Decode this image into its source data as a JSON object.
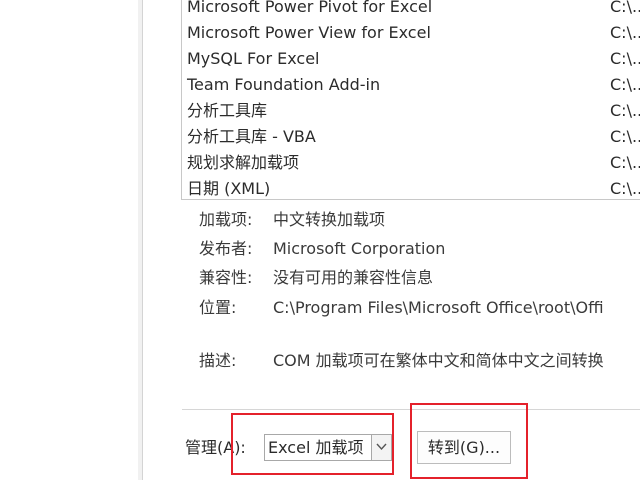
{
  "addins_list": {
    "items": [
      {
        "name": "Microsoft Power Pivot for Excel",
        "location": "C:\\..."
      },
      {
        "name": "Microsoft Power View for Excel",
        "location": "C:\\..."
      },
      {
        "name": "MySQL For Excel",
        "location": "C:\\..."
      },
      {
        "name": "Team Foundation Add-in",
        "location": "C:\\..."
      },
      {
        "name": "分析工具库",
        "location": "C:\\..."
      },
      {
        "name": "分析工具库 - VBA",
        "location": "C:\\..."
      },
      {
        "name": "规划求解加载项",
        "location": "C:\\..."
      },
      {
        "name": "日期 (XML)",
        "location": "C:\\..."
      }
    ]
  },
  "details": {
    "addin_label": "加载项:",
    "addin_value": "中文转换加载项",
    "publisher_label": "发布者:",
    "publisher_value": "Microsoft Corporation",
    "compat_label": "兼容性:",
    "compat_value": "没有可用的兼容性信息",
    "location_label": "位置:",
    "location_value": "C:\\Program Files\\Microsoft Office\\root\\Offi",
    "description_label": "描述:",
    "description_value": "COM 加载项可在繁体中文和简体中文之间转换"
  },
  "manage": {
    "label": "管理(A):",
    "selected": "Excel 加载项",
    "goto_label": "转到(G)..."
  },
  "colors": {
    "highlight": "#e4212b",
    "border": "#c8c8c8"
  }
}
